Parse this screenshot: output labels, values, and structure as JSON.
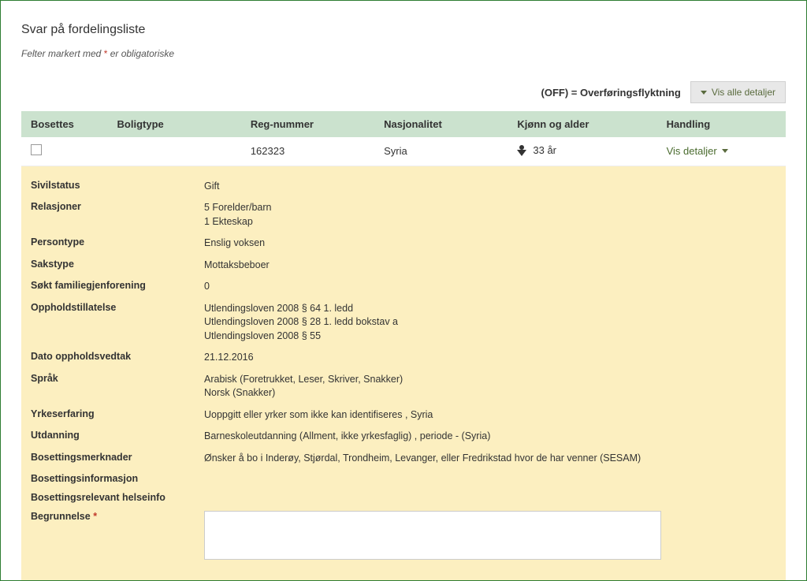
{
  "title": "Svar på fordelingsliste",
  "subtitle_before": "Felter markert med ",
  "subtitle_asterisk": "*",
  "subtitle_after": " er obligatoriske",
  "toolbar": {
    "off_label": "(OFF) = Overføringsflyktning",
    "show_all_btn": "Vis alle detaljer"
  },
  "headers": {
    "bosettes": "Bosettes",
    "boligtype": "Boligtype",
    "regnr": "Reg-nummer",
    "nasjonalitet": "Nasjonalitet",
    "kjonn_alder": "Kjønn og alder",
    "handling": "Handling"
  },
  "row": {
    "boligtype": "",
    "regnr": "162323",
    "nasjonalitet": "Syria",
    "alder": "33 år",
    "handling_btn": "Vis detaljer"
  },
  "details": {
    "sivilstatus_label": "Sivilstatus",
    "sivilstatus_value": "Gift",
    "relasjoner_label": "Relasjoner",
    "relasjoner_value1": "5 Forelder/barn",
    "relasjoner_value2": "1 Ekteskap",
    "persontype_label": "Persontype",
    "persontype_value": "Enslig voksen",
    "sakstype_label": "Sakstype",
    "sakstype_value": "Mottaksbeboer",
    "familiegj_label": "Søkt familiegjenforening",
    "familiegj_value": "0",
    "opphold_label": "Oppholdstillatelse",
    "opphold_value1": "Utlendingsloven 2008 § 64 1. ledd",
    "opphold_value2": "Utlendingsloven 2008 § 28 1. ledd bokstav a",
    "opphold_value3": "Utlendingsloven 2008 § 55",
    "dato_label": "Dato oppholdsvedtak",
    "dato_value": "21.12.2016",
    "sprak_label": "Språk",
    "sprak_value1": "Arabisk (Foretrukket, Leser, Skriver, Snakker)",
    "sprak_value2": "Norsk (Snakker)",
    "yrke_label": "Yrkeserfaring",
    "yrke_value": "Uoppgitt eller yrker som ikke kan identifiseres , Syria",
    "utdanning_label": "Utdanning",
    "utdanning_value": "Barneskoleutdanning (Allment, ikke yrkesfaglig) , periode - (Syria)",
    "merknader_label": "Bosettingsmerknader",
    "merknader_value": "Ønsker å bo i Inderøy, Stjørdal, Trondheim, Levanger, eller Fredrikstad hvor de har venner (SESAM)",
    "info_label": "Bosettingsinformasjon",
    "info_value": "",
    "helse_label": "Bosettingsrelevant helseinfo",
    "helse_value": "",
    "begrunnelse_label": "Begrunnelse",
    "begrunnelse_required": "*",
    "begrunnelse_value": ""
  }
}
